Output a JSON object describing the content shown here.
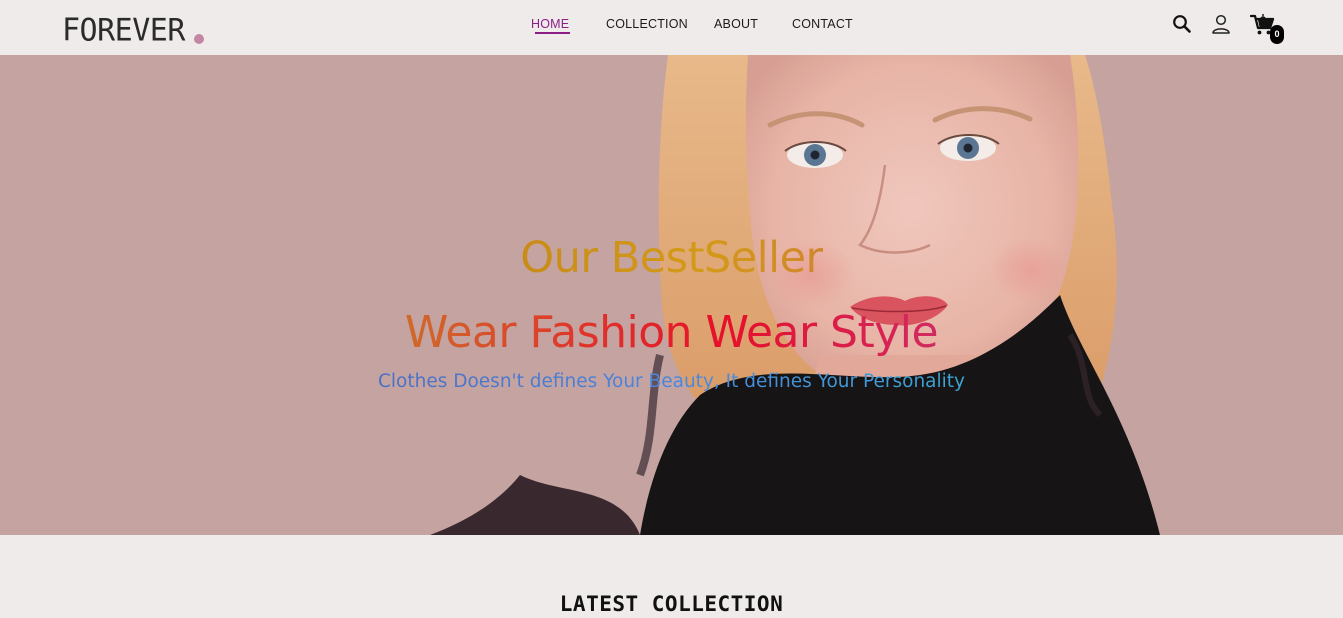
{
  "brand": {
    "logo_text": "FOREVER",
    "accent": "#c586a5"
  },
  "nav": {
    "items": [
      {
        "label": "HOME",
        "active": true
      },
      {
        "label": "COLLECTION",
        "active": false
      },
      {
        "label": "ABOUT",
        "active": false
      },
      {
        "label": "CONTACT",
        "active": false
      }
    ],
    "active_color": "#8a1f86"
  },
  "header_icons": {
    "search": "search-icon",
    "profile": "user-icon",
    "cart": "cart-icon",
    "cart_count": "0"
  },
  "hero": {
    "headline_small": "Our BestSeller",
    "headline_large": "Wear Fashion Wear Style",
    "subheadline": "Clothes Doesn't defines Your Beauty, It defines Your Personality",
    "background_color": "#c4a3a1"
  },
  "latest_collection": {
    "title": "LATEST COLLECTION"
  }
}
